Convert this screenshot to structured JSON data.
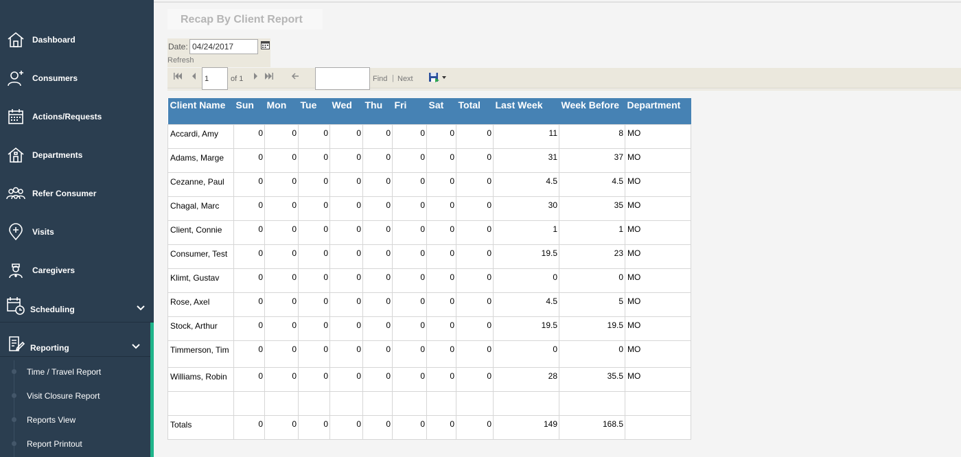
{
  "sidebar": {
    "items": [
      {
        "label": "Dashboard",
        "icon": "home-icon"
      },
      {
        "label": "Consumers",
        "icon": "user-add-icon"
      },
      {
        "label": "Actions/Requests",
        "icon": "calendar-grid-icon"
      },
      {
        "label": "Departments",
        "icon": "building-icon"
      },
      {
        "label": "Refer Consumer",
        "icon": "group-icon"
      },
      {
        "label": "Visits",
        "icon": "map-pin-plus-icon"
      },
      {
        "label": "Caregivers",
        "icon": "nurse-icon"
      },
      {
        "label": "Scheduling",
        "icon": "calendar-clock-icon"
      },
      {
        "label": "Reporting",
        "icon": "report-edit-icon"
      }
    ],
    "reporting_sub": [
      {
        "label": "Time / Travel Report"
      },
      {
        "label": "Visit Closure Report"
      },
      {
        "label": "Reports View"
      },
      {
        "label": "Report Printout"
      }
    ],
    "accent_color": "#1fb48a",
    "background_color": "#2b3e50"
  },
  "report": {
    "title": "Recap By Client Report",
    "date_label": "Date:",
    "date_value": "04/24/2017",
    "refresh_label": "Refresh"
  },
  "toolbar": {
    "page_value": "1",
    "of_label": "of 1",
    "find_label": "Find",
    "separator": "|",
    "next_label": "Next"
  },
  "table": {
    "header_color": "#4682b4",
    "columns": [
      "Client Name",
      "Sun",
      "Mon",
      "Tue",
      "Wed",
      "Thu",
      "Fri",
      "Sat",
      "Total",
      "Last Week",
      "Week Before",
      "Department"
    ],
    "rows": [
      [
        "Accardi, Amy",
        "0",
        "0",
        "0",
        "0",
        "0",
        "0",
        "0",
        "0",
        "11",
        "8",
        "MO"
      ],
      [
        "Adams, Marge",
        "0",
        "0",
        "0",
        "0",
        "0",
        "0",
        "0",
        "0",
        "31",
        "37",
        "MO"
      ],
      [
        "Cezanne, Paul",
        "0",
        "0",
        "0",
        "0",
        "0",
        "0",
        "0",
        "0",
        "4.5",
        "4.5",
        "MO"
      ],
      [
        "Chagal, Marc",
        "0",
        "0",
        "0",
        "0",
        "0",
        "0",
        "0",
        "0",
        "30",
        "35",
        "MO"
      ],
      [
        "Client, Connie",
        "0",
        "0",
        "0",
        "0",
        "0",
        "0",
        "0",
        "0",
        "1",
        "1",
        "MO"
      ],
      [
        "Consumer, Test",
        "0",
        "0",
        "0",
        "0",
        "0",
        "0",
        "0",
        "0",
        "19.5",
        "23",
        "MO"
      ],
      [
        "Klimt, Gustav",
        "0",
        "0",
        "0",
        "0",
        "0",
        "0",
        "0",
        "0",
        "0",
        "0",
        "MO"
      ],
      [
        "Rose, Axel",
        "0",
        "0",
        "0",
        "0",
        "0",
        "0",
        "0",
        "0",
        "4.5",
        "5",
        "MO"
      ],
      [
        "Stock, Arthur",
        "0",
        "0",
        "0",
        "0",
        "0",
        "0",
        "0",
        "0",
        "19.5",
        "19.5",
        "MO"
      ],
      [
        "Timmerson, Tim",
        "0",
        "0",
        "0",
        "0",
        "0",
        "0",
        "0",
        "0",
        "0",
        "0",
        "MO"
      ],
      [
        "Williams, Robin",
        "0",
        "0",
        "0",
        "0",
        "0",
        "0",
        "0",
        "0",
        "28",
        "35.5",
        "MO"
      ]
    ],
    "totals": [
      "Totals",
      "0",
      "0",
      "0",
      "0",
      "0",
      "0",
      "0",
      "0",
      "149",
      "168.5",
      ""
    ]
  }
}
